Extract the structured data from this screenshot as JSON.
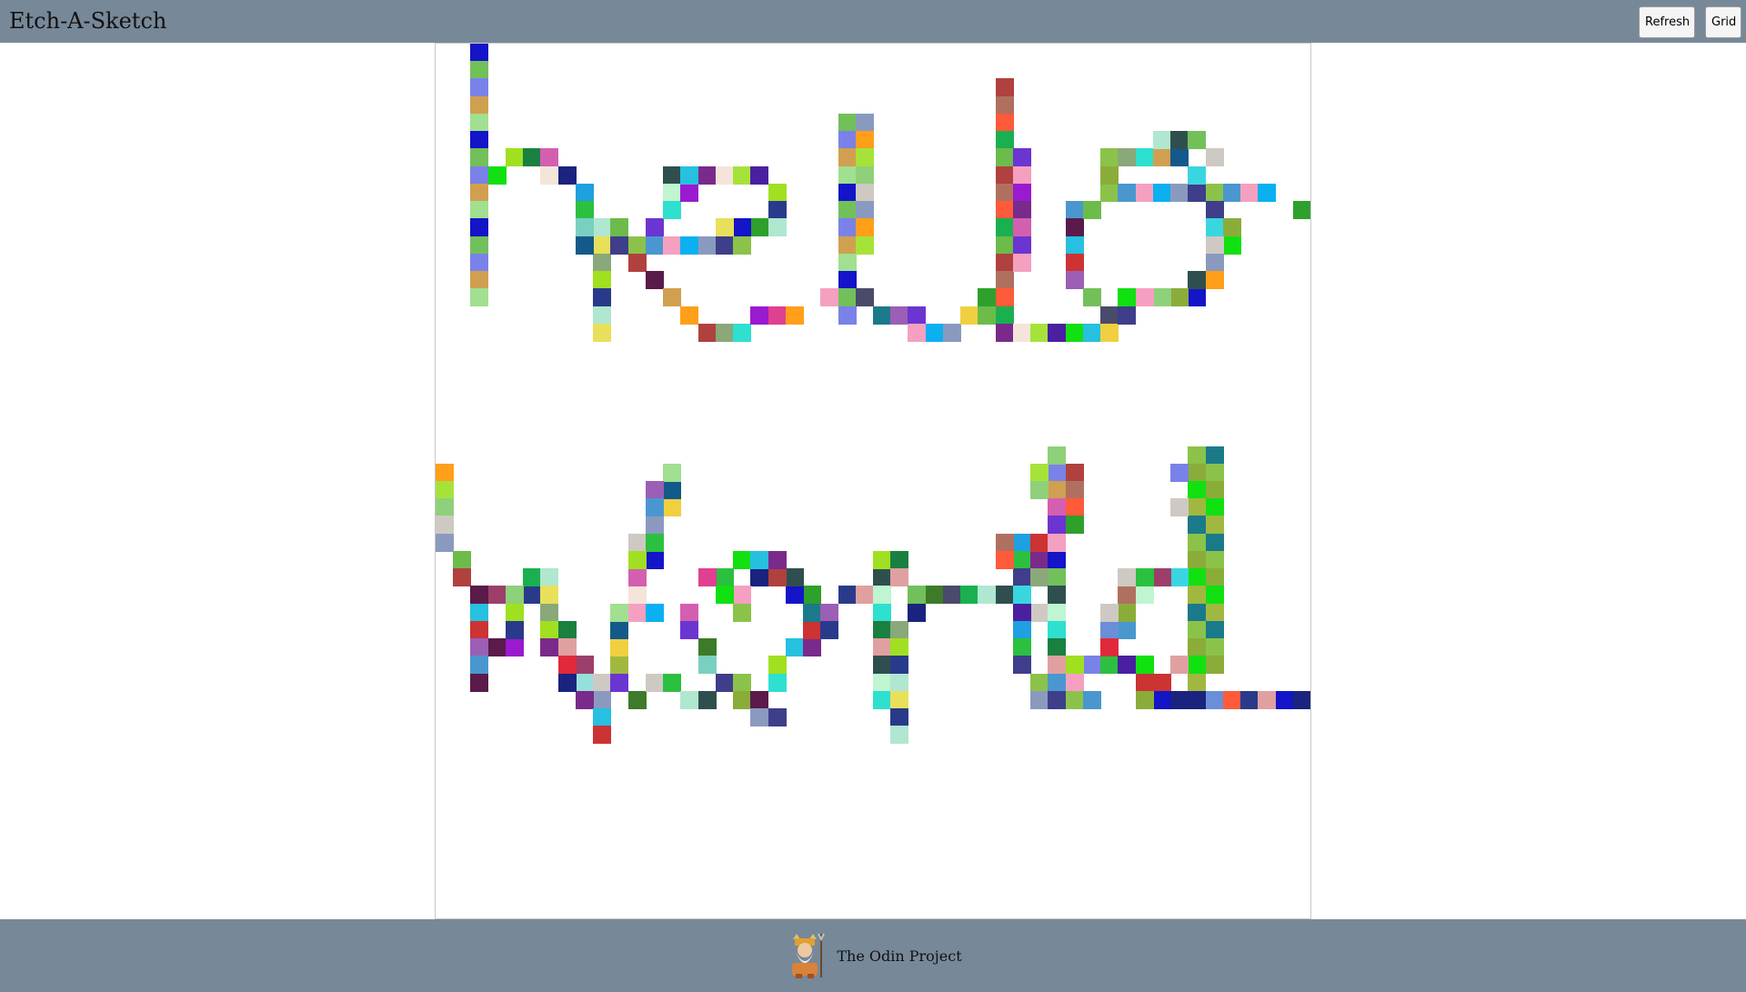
{
  "header": {
    "title": "Etch-A-Sketch",
    "refresh_label": "Refresh",
    "grid_label": "Grid",
    "background": "#778899"
  },
  "canvas": {
    "grid_size": 50,
    "drawing_text": [
      "hello",
      "world"
    ],
    "default_cell_color": "#ffffff",
    "palette": [
      "#6dbb4a",
      "#d45fb0",
      "#2ea02c",
      "#9b5fb5",
      "#e02a3b",
      "#8bc34a",
      "#1414c8",
      "#3ad6e0",
      "#2f4f4f",
      "#a6e33a",
      "#e8e05a",
      "#9b3f6a",
      "#b0413e",
      "#6b35d1",
      "#c9c39a",
      "#4a97d0",
      "#1a237e",
      "#8aad3a",
      "#72c05a",
      "#4a20a0",
      "#bff5d0",
      "#8fd07a",
      "#8aa87a",
      "#95e0da",
      "#b07060",
      "#f5a0c0",
      "#6a8fd8",
      "#5a1a4a",
      "#3d7a2a",
      "#11e011",
      "#7a82e8",
      "#1fa0e0",
      "#2ee0d0",
      "#cfc9c3",
      "#a0e020",
      "#0ab0f0",
      "#ff5a3a",
      "#9a1ad0",
      "#4a4a6a",
      "#26c0e0",
      "#7ad0c0",
      "#a0b840",
      "#d0a050",
      "#2cc040",
      "#1a8040",
      "#8a9abf",
      "#2a3a8a",
      "#e04090",
      "#1ab050",
      "#7a2a8a",
      "#f0d040",
      "#cc3333",
      "#135a8a",
      "#1a7a8a",
      "#a0e090",
      "#3e3e8a",
      "#e0a0a0",
      "#ff9f1a",
      "#b0e7d0",
      "#f4e4da"
    ]
  },
  "footer": {
    "label": "The Odin Project",
    "logo_icon": "odin-logo-icon",
    "background": "#778899"
  }
}
